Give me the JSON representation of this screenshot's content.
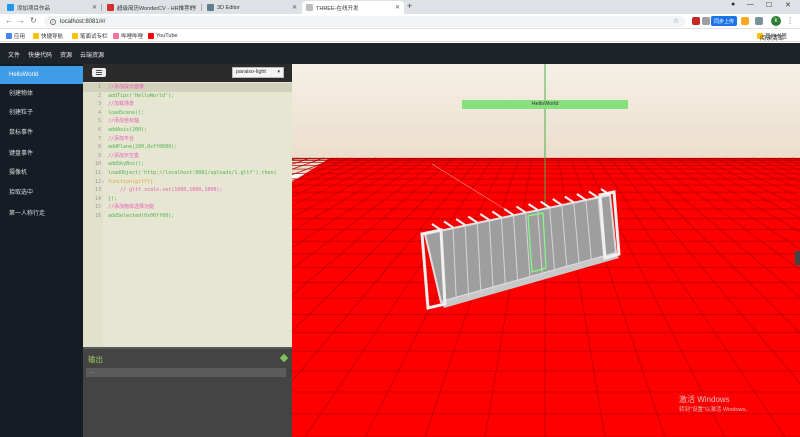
{
  "browser": {
    "tabs": [
      {
        "title": "添加项目作品",
        "color": "#2196f3",
        "active": false
      },
      {
        "title": "超级简历WonderCV - HR推荐的",
        "color": "#d32f2f",
        "active": false
      },
      {
        "title": "3D Editor",
        "color": "#607d8b",
        "active": false
      },
      {
        "title": "THREE-在线开发",
        "color": "#9e9e9e",
        "active": true
      }
    ],
    "new_tab": "+",
    "url": "localhost:8081/#/",
    "sync_label": "同步上传",
    "avatar_letter": "k",
    "bookmarks": [
      {
        "label": "应用",
        "color": "#4285f4"
      },
      {
        "label": "快捷导航",
        "color": "#ffc107"
      },
      {
        "label": "笔面试专栏",
        "color": "#ffc107"
      },
      {
        "label": "哔哩哔哩",
        "color": "#fb7299"
      },
      {
        "label": "YouTube",
        "color": "#ff0000"
      }
    ],
    "other_bookmarks": "其他书签",
    "reading_list": "阅读清单"
  },
  "app": {
    "menu": [
      "文件",
      "快捷代码",
      "资源",
      "云端资源"
    ],
    "sidebar": [
      {
        "label": "HelloWorld",
        "active": true
      },
      {
        "label": "创建物体",
        "active": false
      },
      {
        "label": "创建粒子",
        "active": false
      },
      {
        "label": "鼠标事件",
        "active": false
      },
      {
        "label": "键盘事件",
        "active": false
      },
      {
        "label": "摄像机",
        "active": false
      },
      {
        "label": "拾取选中",
        "active": false
      },
      {
        "label": "第一人称行走",
        "active": false
      }
    ],
    "theme": "paraiso-light",
    "code": [
      {
        "n": "1",
        "text": "//添加提示面板",
        "kind": "comment"
      },
      {
        "n": "2",
        "text": "addTips('HelloWorld');",
        "kind": "green"
      },
      {
        "n": "3",
        "text": "//加载场景",
        "kind": "comment"
      },
      {
        "n": "4",
        "text": "loadScene();",
        "kind": "green"
      },
      {
        "n": "5",
        "text": "//添加坐标轴",
        "kind": "comment"
      },
      {
        "n": "6",
        "text": "addAxis(200);",
        "kind": "green"
      },
      {
        "n": "7",
        "text": "//添加平台",
        "kind": "comment"
      },
      {
        "n": "8",
        "text": "addPlane(200,0xff0000);",
        "kind": "green"
      },
      {
        "n": "9",
        "text": "//添加天空盒",
        "kind": "comment"
      },
      {
        "n": "10",
        "text": "addSkyBox();",
        "kind": "green"
      },
      {
        "n": "11",
        "text": "loadObject('http://localhost:8081/uploads/1.gltf').then(",
        "kind": "green"
      },
      {
        "n": "12",
        "text": "function(gltf){",
        "kind": "gold"
      },
      {
        "n": "13",
        "text": "    // gltf.scale.set(1000,1000,1000);",
        "kind": "comment"
      },
      {
        "n": "14",
        "text": "});",
        "kind": "green"
      },
      {
        "n": "15",
        "text": "//添加物体选择功能",
        "kind": "comment"
      },
      {
        "n": "16",
        "text": "addSelected(0x00ff00);",
        "kind": "green"
      }
    ],
    "output_title": "输出",
    "output_line": "...",
    "viewport": {
      "label": "HelloWorld",
      "plane_color": "#ff0000",
      "watermark_title": "激活 Windows",
      "watermark_sub": "转到\"设置\"以激活 Windows。"
    }
  }
}
